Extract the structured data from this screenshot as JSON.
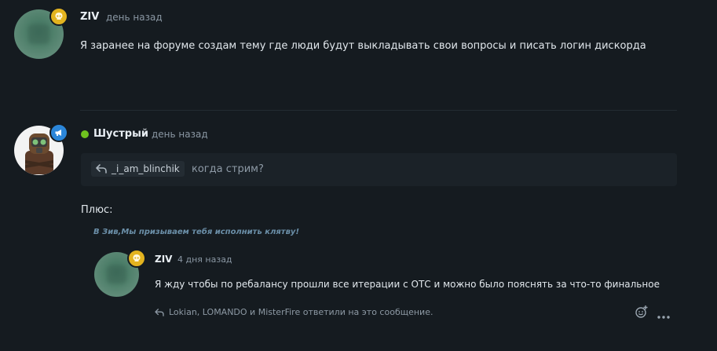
{
  "colors": {
    "background": "#151b20",
    "online": "#6fc21f",
    "gold_badge": "#e3b31f",
    "blue_badge": "#2b86d9",
    "oath_text": "#6b8fa8"
  },
  "post1": {
    "username": "ZIV",
    "time": "день назад",
    "badge_icon": "skull-icon",
    "text": "Я заранее на форуме создам тему где люди будут выкладывать свои вопросы и писать логин дискорда"
  },
  "post2": {
    "username": "Шустрый",
    "time": "день назад",
    "badge_icon": "megaphone-icon",
    "online_icon": "online-dot-icon",
    "reply_to": {
      "icon": "reply-arrow-icon",
      "user": "_i_am_blinchik",
      "text": "когда стрим?"
    },
    "text": "Плюс:",
    "oath": "В Зив,Мы призываем тебя исполнить клятву!",
    "embedded": {
      "username": "ZIV",
      "time": "4 дня назад",
      "badge_icon": "skull-icon",
      "text": "Я жду чтобы по ребалансу прошли все итерации с ОТС и можно было пояснять за что-то финальное",
      "replies_text": "Lokian, LOMANDO и MisterFire ответили на это сообщение.",
      "actions": [
        "add-reaction-icon",
        "more-options-icon"
      ]
    }
  }
}
